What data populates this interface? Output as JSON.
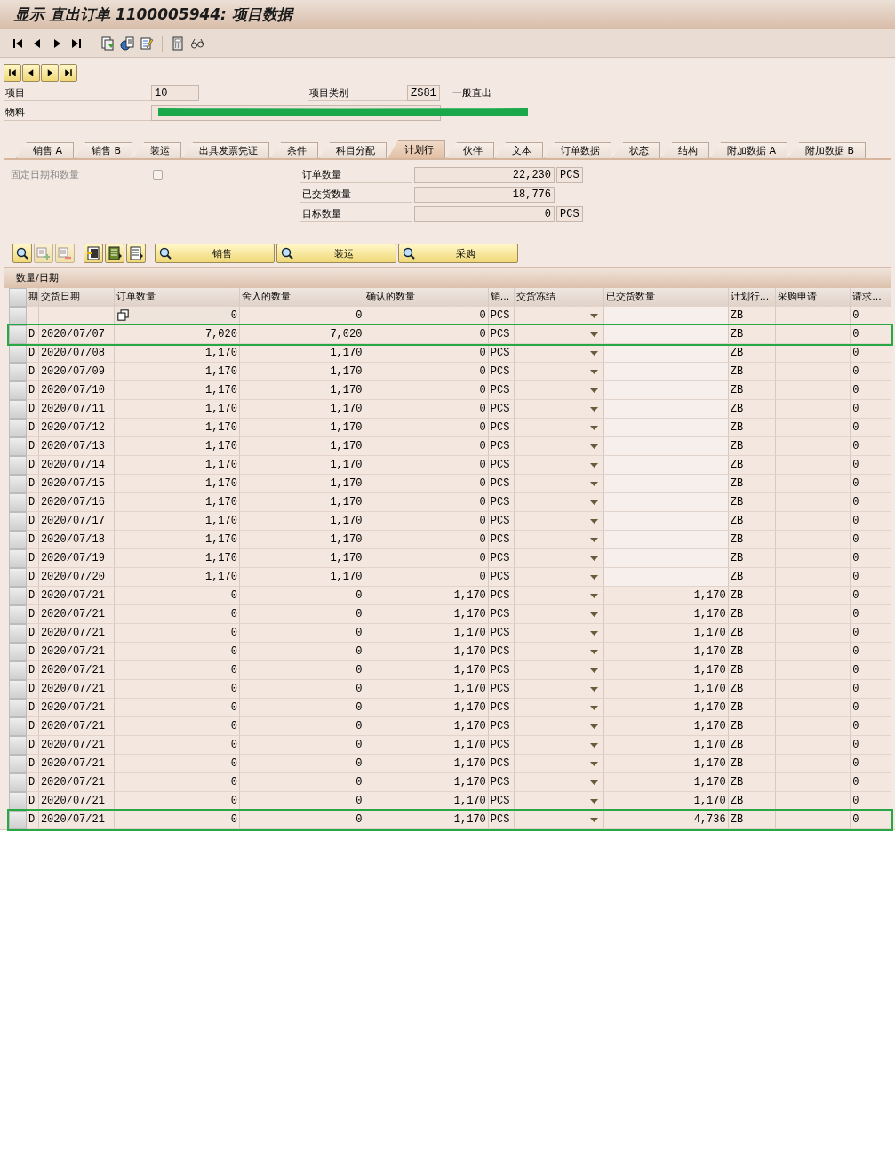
{
  "window": {
    "title": "显示 直出订单 1100005944: 项目数据"
  },
  "toolbar": [
    {
      "kind": "first"
    },
    {
      "kind": "prev"
    },
    {
      "kind": "next"
    },
    {
      "kind": "last"
    },
    {
      "kind": "sep"
    },
    {
      "kind": "doc"
    },
    {
      "kind": "globe"
    },
    {
      "kind": "edit"
    },
    {
      "kind": "sep"
    },
    {
      "kind": "calc"
    },
    {
      "kind": "glasses"
    }
  ],
  "item_nav": [
    {
      "kind": "first"
    },
    {
      "kind": "prev"
    },
    {
      "kind": "next"
    },
    {
      "kind": "last"
    }
  ],
  "header": {
    "item_label": "项目",
    "item_value": "10",
    "category_label": "项目类别",
    "category_value": "ZS81",
    "category_text": "一般直出",
    "material_label": "物料",
    "material_redacted": true
  },
  "tabs": [
    {
      "label": "销售 A",
      "selected": false
    },
    {
      "label": "销售 B",
      "selected": false
    },
    {
      "label": "装运",
      "selected": false
    },
    {
      "label": "出具发票凭证",
      "selected": false
    },
    {
      "label": "条件",
      "selected": false
    },
    {
      "label": "科目分配",
      "selected": false
    },
    {
      "label": "计划行",
      "selected": true
    },
    {
      "label": "伙伴",
      "selected": false
    },
    {
      "label": "文本",
      "selected": false
    },
    {
      "label": "订单数据",
      "selected": false
    },
    {
      "label": "状态",
      "selected": false
    },
    {
      "label": "结构",
      "selected": false
    },
    {
      "label": "附加数据 A",
      "selected": false
    },
    {
      "label": "附加数据 B",
      "selected": false
    }
  ],
  "fixed_date": {
    "label": "固定日期和数量",
    "checked": false,
    "disabled": true
  },
  "quantities": [
    {
      "label": "订单数量",
      "value": "22,230",
      "unit": "PCS"
    },
    {
      "label": "已交货数量",
      "value": "18,776"
    },
    {
      "label": "目标数量",
      "value": "0",
      "unit": "PCS"
    }
  ],
  "table_toolbar": [
    {
      "kind": "detail",
      "disabled": false
    },
    {
      "kind": "insert",
      "disabled": true
    },
    {
      "kind": "delete",
      "disabled": true
    },
    {
      "kind": "select-all",
      "disabled": false
    },
    {
      "kind": "select-block",
      "disabled": false
    },
    {
      "kind": "deselect",
      "disabled": false
    },
    {
      "kind": "text",
      "label": "销售",
      "disabled": false
    },
    {
      "kind": "text",
      "label": "装运",
      "disabled": false
    },
    {
      "kind": "text",
      "label": "采购",
      "disabled": false
    }
  ],
  "table": {
    "title": "数量/日期",
    "columns": [
      "期",
      "交货日期",
      "订单数量",
      "舍入的数量",
      "确认的数量",
      "销...",
      "交货冻结",
      "已交货数量",
      "计划行...",
      "采购申请",
      "请求..."
    ],
    "rows": [
      {
        "kind": "new",
        "order_qty": "0",
        "rounded_qty": "0",
        "confirmed_qty": "0",
        "unit": "PCS",
        "schedule_type": "ZB",
        "request": "0",
        "highlighted": false
      },
      {
        "kind": "line",
        "period": "D",
        "date": "2020/07/07",
        "order_qty": "7,020",
        "rounded_qty": "7,020",
        "confirmed_qty": "0",
        "unit": "PCS",
        "schedule_type": "ZB",
        "request": "0",
        "highlighted": true
      },
      {
        "kind": "line",
        "period": "D",
        "date": "2020/07/08",
        "order_qty": "1,170",
        "rounded_qty": "1,170",
        "confirmed_qty": "0",
        "unit": "PCS",
        "schedule_type": "ZB",
        "request": "0",
        "highlighted": false
      },
      {
        "kind": "line",
        "period": "D",
        "date": "2020/07/09",
        "order_qty": "1,170",
        "rounded_qty": "1,170",
        "confirmed_qty": "0",
        "unit": "PCS",
        "schedule_type": "ZB",
        "request": "0",
        "highlighted": false
      },
      {
        "kind": "line",
        "period": "D",
        "date": "2020/07/10",
        "order_qty": "1,170",
        "rounded_qty": "1,170",
        "confirmed_qty": "0",
        "unit": "PCS",
        "schedule_type": "ZB",
        "request": "0",
        "highlighted": false
      },
      {
        "kind": "line",
        "period": "D",
        "date": "2020/07/11",
        "order_qty": "1,170",
        "rounded_qty": "1,170",
        "confirmed_qty": "0",
        "unit": "PCS",
        "schedule_type": "ZB",
        "request": "0",
        "highlighted": false
      },
      {
        "kind": "line",
        "period": "D",
        "date": "2020/07/12",
        "order_qty": "1,170",
        "rounded_qty": "1,170",
        "confirmed_qty": "0",
        "unit": "PCS",
        "schedule_type": "ZB",
        "request": "0",
        "highlighted": false
      },
      {
        "kind": "line",
        "period": "D",
        "date": "2020/07/13",
        "order_qty": "1,170",
        "rounded_qty": "1,170",
        "confirmed_qty": "0",
        "unit": "PCS",
        "schedule_type": "ZB",
        "request": "0",
        "highlighted": false
      },
      {
        "kind": "line",
        "period": "D",
        "date": "2020/07/14",
        "order_qty": "1,170",
        "rounded_qty": "1,170",
        "confirmed_qty": "0",
        "unit": "PCS",
        "schedule_type": "ZB",
        "request": "0",
        "highlighted": false
      },
      {
        "kind": "line",
        "period": "D",
        "date": "2020/07/15",
        "order_qty": "1,170",
        "rounded_qty": "1,170",
        "confirmed_qty": "0",
        "unit": "PCS",
        "schedule_type": "ZB",
        "request": "0",
        "highlighted": false
      },
      {
        "kind": "line",
        "period": "D",
        "date": "2020/07/16",
        "order_qty": "1,170",
        "rounded_qty": "1,170",
        "confirmed_qty": "0",
        "unit": "PCS",
        "schedule_type": "ZB",
        "request": "0",
        "highlighted": false
      },
      {
        "kind": "line",
        "period": "D",
        "date": "2020/07/17",
        "order_qty": "1,170",
        "rounded_qty": "1,170",
        "confirmed_qty": "0",
        "unit": "PCS",
        "schedule_type": "ZB",
        "request": "0",
        "highlighted": false
      },
      {
        "kind": "line",
        "period": "D",
        "date": "2020/07/18",
        "order_qty": "1,170",
        "rounded_qty": "1,170",
        "confirmed_qty": "0",
        "unit": "PCS",
        "schedule_type": "ZB",
        "request": "0",
        "highlighted": false
      },
      {
        "kind": "line",
        "period": "D",
        "date": "2020/07/19",
        "order_qty": "1,170",
        "rounded_qty": "1,170",
        "confirmed_qty": "0",
        "unit": "PCS",
        "schedule_type": "ZB",
        "request": "0",
        "highlighted": false
      },
      {
        "kind": "line",
        "period": "D",
        "date": "2020/07/20",
        "order_qty": "1,170",
        "rounded_qty": "1,170",
        "confirmed_qty": "0",
        "unit": "PCS",
        "schedule_type": "ZB",
        "request": "0",
        "highlighted": false
      },
      {
        "kind": "line",
        "period": "D",
        "date": "2020/07/21",
        "order_qty": "0",
        "rounded_qty": "0",
        "confirmed_qty": "1,170",
        "unit": "PCS",
        "delivered_qty": "1,170",
        "schedule_type": "ZB",
        "request": "0",
        "highlighted": false
      },
      {
        "kind": "line",
        "period": "D",
        "date": "2020/07/21",
        "order_qty": "0",
        "rounded_qty": "0",
        "confirmed_qty": "1,170",
        "unit": "PCS",
        "delivered_qty": "1,170",
        "schedule_type": "ZB",
        "request": "0",
        "highlighted": false
      },
      {
        "kind": "line",
        "period": "D",
        "date": "2020/07/21",
        "order_qty": "0",
        "rounded_qty": "0",
        "confirmed_qty": "1,170",
        "unit": "PCS",
        "delivered_qty": "1,170",
        "schedule_type": "ZB",
        "request": "0",
        "highlighted": false
      },
      {
        "kind": "line",
        "period": "D",
        "date": "2020/07/21",
        "order_qty": "0",
        "rounded_qty": "0",
        "confirmed_qty": "1,170",
        "unit": "PCS",
        "delivered_qty": "1,170",
        "schedule_type": "ZB",
        "request": "0",
        "highlighted": false
      },
      {
        "kind": "line",
        "period": "D",
        "date": "2020/07/21",
        "order_qty": "0",
        "rounded_qty": "0",
        "confirmed_qty": "1,170",
        "unit": "PCS",
        "delivered_qty": "1,170",
        "schedule_type": "ZB",
        "request": "0",
        "highlighted": false
      },
      {
        "kind": "line",
        "period": "D",
        "date": "2020/07/21",
        "order_qty": "0",
        "rounded_qty": "0",
        "confirmed_qty": "1,170",
        "unit": "PCS",
        "delivered_qty": "1,170",
        "schedule_type": "ZB",
        "request": "0",
        "highlighted": false
      },
      {
        "kind": "line",
        "period": "D",
        "date": "2020/07/21",
        "order_qty": "0",
        "rounded_qty": "0",
        "confirmed_qty": "1,170",
        "unit": "PCS",
        "delivered_qty": "1,170",
        "schedule_type": "ZB",
        "request": "0",
        "highlighted": false
      },
      {
        "kind": "line",
        "period": "D",
        "date": "2020/07/21",
        "order_qty": "0",
        "rounded_qty": "0",
        "confirmed_qty": "1,170",
        "unit": "PCS",
        "delivered_qty": "1,170",
        "schedule_type": "ZB",
        "request": "0",
        "highlighted": false
      },
      {
        "kind": "line",
        "period": "D",
        "date": "2020/07/21",
        "order_qty": "0",
        "rounded_qty": "0",
        "confirmed_qty": "1,170",
        "unit": "PCS",
        "delivered_qty": "1,170",
        "schedule_type": "ZB",
        "request": "0",
        "highlighted": false
      },
      {
        "kind": "line",
        "period": "D",
        "date": "2020/07/21",
        "order_qty": "0",
        "rounded_qty": "0",
        "confirmed_qty": "1,170",
        "unit": "PCS",
        "delivered_qty": "1,170",
        "schedule_type": "ZB",
        "request": "0",
        "highlighted": false
      },
      {
        "kind": "line",
        "period": "D",
        "date": "2020/07/21",
        "order_qty": "0",
        "rounded_qty": "0",
        "confirmed_qty": "1,170",
        "unit": "PCS",
        "delivered_qty": "1,170",
        "schedule_type": "ZB",
        "request": "0",
        "highlighted": false
      },
      {
        "kind": "line",
        "period": "D",
        "date": "2020/07/21",
        "order_qty": "0",
        "rounded_qty": "0",
        "confirmed_qty": "1,170",
        "unit": "PCS",
        "delivered_qty": "1,170",
        "schedule_type": "ZB",
        "request": "0",
        "highlighted": false
      },
      {
        "kind": "line",
        "period": "D",
        "date": "2020/07/21",
        "order_qty": "0",
        "rounded_qty": "0",
        "confirmed_qty": "1,170",
        "unit": "PCS",
        "delivered_qty": "4,736",
        "schedule_type": "ZB",
        "request": "0",
        "highlighted": true
      }
    ]
  }
}
